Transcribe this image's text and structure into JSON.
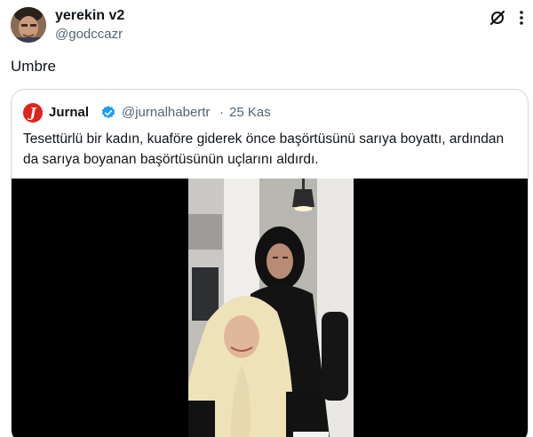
{
  "tweet": {
    "author_name": "yerekin v2",
    "author_handle": "@godccazr",
    "text": "Umbre"
  },
  "quote": {
    "avatar_letter": "J",
    "author_name": "Jurnal",
    "author_handle": "@jurnalhabertr",
    "separator": "·",
    "date": "25 Kas",
    "text": "Tesettürlü bir kadın, kuaföre giderek önce başörtüsünü sarıya boyattı, ardından da sarıya boyanan başörtüsünün uçlarını aldırdı.",
    "accent_color": "#e0241b",
    "verified_color": "#1d9bf0"
  },
  "icons": {
    "grok": "grok-icon",
    "more": "more-icon",
    "verified": "verified-badge-icon"
  }
}
